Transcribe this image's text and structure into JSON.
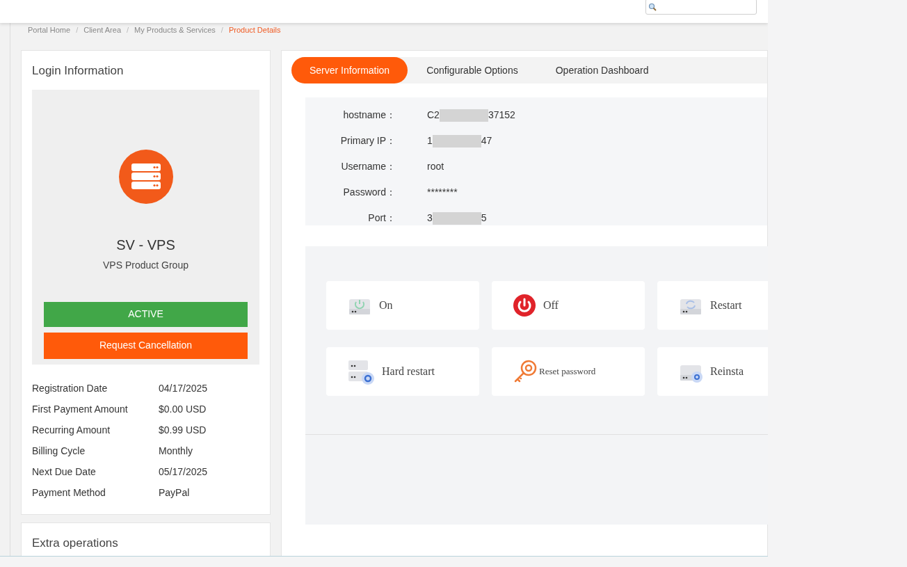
{
  "breadcrumb_separator": "/",
  "breadcrumb": [
    {
      "label": "Portal Home",
      "current": false
    },
    {
      "label": "Client Area",
      "current": false
    },
    {
      "label": "My Products & Services",
      "current": false
    },
    {
      "label": "Product Details",
      "current": true
    }
  ],
  "login_info": {
    "title": "Login Information",
    "product_name": "SV - VPS",
    "product_group": "VPS Product Group",
    "status": "ACTIVE",
    "cancel_button": "Request Cancellation",
    "details": [
      {
        "label": "Registration Date",
        "value": "04/17/2025"
      },
      {
        "label": "First Payment Amount",
        "value": "$0.00 USD"
      },
      {
        "label": "Recurring Amount",
        "value": "$0.99 USD"
      },
      {
        "label": "Billing Cycle",
        "value": "Monthly"
      },
      {
        "label": "Next Due Date",
        "value": "05/17/2025"
      },
      {
        "label": "Payment Method",
        "value": "PayPal"
      }
    ]
  },
  "extra_operations": {
    "title": "Extra operations"
  },
  "tabs": [
    {
      "label": "Server Information",
      "selected": true
    },
    {
      "label": "Configurable Options",
      "selected": false
    },
    {
      "label": "Operation Dashboard",
      "selected": false
    }
  ],
  "server_info": [
    {
      "label": "hostname：",
      "value": [
        "C2",
        "37152"
      ]
    },
    {
      "label": "Primary IP：",
      "value": [
        "1",
        "47"
      ]
    },
    {
      "label": "Username：",
      "value": [
        "root"
      ]
    },
    {
      "label": "Password：",
      "value": [
        "********"
      ]
    },
    {
      "label": "Port：",
      "value": [
        "3",
        "5"
      ]
    }
  ],
  "actions": [
    {
      "label": "On",
      "kind": "on"
    },
    {
      "label": "Off",
      "kind": "off"
    },
    {
      "label": "Restart",
      "kind": "restart"
    },
    {
      "label": "Hard restart",
      "kind": "hard-restart"
    },
    {
      "label": "Reset password",
      "kind": "reset-password"
    },
    {
      "label": "Reinsta",
      "kind": "reinstall"
    }
  ]
}
